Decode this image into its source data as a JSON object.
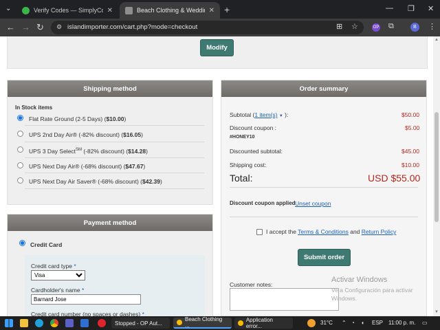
{
  "browser": {
    "tabs": [
      {
        "title": "Verify Codes — SimplyCodes",
        "fav_color": "#3bb54a"
      },
      {
        "title": "Beach Clothing & Wedding Att",
        "fav_color": "#8e8e8e"
      }
    ],
    "url": "islandimporter.com/cart.php?mode=checkout",
    "profile_initial": "B"
  },
  "top": {
    "modify_label": "Modify"
  },
  "shipping": {
    "title": "Shipping method",
    "section_label": "In Stock items",
    "options": [
      {
        "name": "Flat Rate Ground (2-5 Days) (",
        "price": "$10.00",
        "tail": ")",
        "selected": true
      },
      {
        "name": "UPS 2nd Day Air® (-82% discount) (",
        "price": "$16.05",
        "tail": ")",
        "selected": false
      },
      {
        "name": "UPS 3 Day Select",
        "sup": "SM",
        "mid": " (-82% discount) (",
        "price": "$14.28",
        "tail": ")",
        "selected": false
      },
      {
        "name": "UPS Next Day Air® (-68% discount) (",
        "price": "$47.67",
        "tail": ")",
        "selected": false
      },
      {
        "name": "UPS Next Day Air Saver® (-68% discount) (",
        "price": "$42.39",
        "tail": ")",
        "selected": false
      }
    ]
  },
  "payment": {
    "title": "Payment method",
    "credit_card_label": "Credit Card",
    "card_type_label": "Credit card type",
    "card_type_value": "Visa",
    "cardholder_label": "Cardholder's name",
    "cardholder_value": "Barnard Jose",
    "card_number_label": "Credit card number (no spaces or dashes)",
    "required_mark": "*"
  },
  "summary": {
    "title": "Order summary",
    "subtotal_label": "Subtotal (",
    "subtotal_items": "1 item(s)",
    "subtotal_tail": " ):",
    "subtotal_value": "$50.00",
    "discount_label": "Discount coupon :",
    "discount_value": "$5.00",
    "coupon_code": "#HONEY10",
    "discounted_label": "Discounted subtotal:",
    "discounted_value": "$45.00",
    "shipping_label": "Shipping cost:",
    "shipping_value": "$10.00",
    "total_label": "Total:",
    "total_value": "USD $55.00",
    "coupon_applied_label": "Discount coupon applied",
    "unset_coupon_label": "Unset coupon",
    "terms_prefix": "I accept the ",
    "terms_link": "Terms & Conditions",
    "terms_and": " and ",
    "return_link": "Return Policy",
    "submit_label": "Submit order",
    "notes_label": "Customer notes:"
  },
  "watermark": {
    "line1": "Activar Windows",
    "line2": "Ve a Configuración para activar",
    "line3": "Windows."
  },
  "taskbar": {
    "apps": [
      {
        "label": "Stopped - OP Aut..."
      },
      {
        "label": "Beach Clothing ..."
      },
      {
        "label": "Application error..."
      }
    ],
    "temperature": "31°C",
    "language": "ESP",
    "time": "11:00 p. m."
  }
}
